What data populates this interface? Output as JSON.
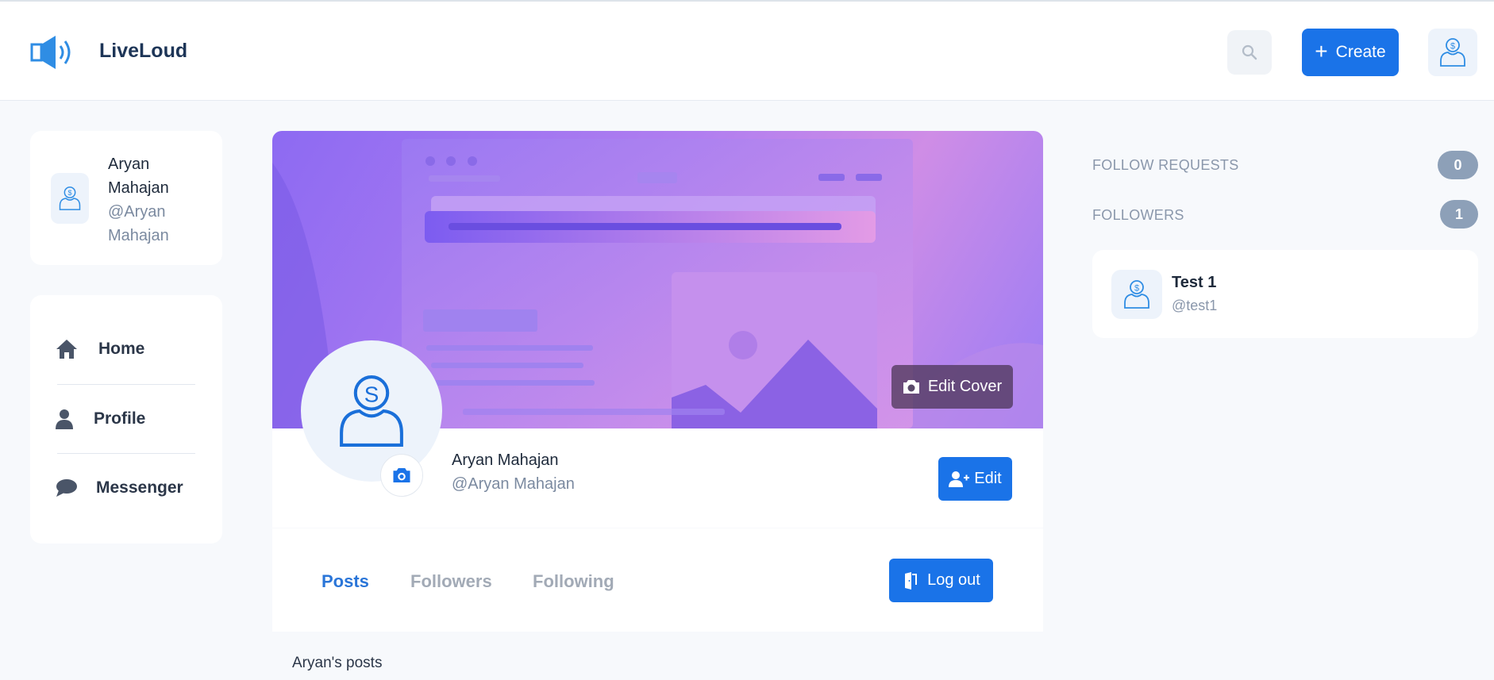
{
  "header": {
    "brand": "LiveLoud",
    "create_label": "Create"
  },
  "sidebar": {
    "user": {
      "name": "Aryan Mahajan",
      "handle": "@Aryan Mahajan"
    },
    "nav": [
      {
        "label": "Home",
        "icon": "home-icon"
      },
      {
        "label": "Profile",
        "icon": "user-icon"
      },
      {
        "label": "Messenger",
        "icon": "chat-icon"
      }
    ]
  },
  "profile": {
    "name": "Aryan Mahajan",
    "handle": "@Aryan Mahajan",
    "edit_cover_label": "Edit Cover",
    "edit_label": "Edit",
    "tabs": [
      {
        "label": "Posts",
        "active": true
      },
      {
        "label": "Followers",
        "active": false
      },
      {
        "label": "Following",
        "active": false
      }
    ],
    "logout_label": "Log out",
    "posts_title": "Aryan's posts"
  },
  "right": {
    "follow_requests_label": "FOLLOW REQUESTS",
    "follow_requests_count": "0",
    "followers_label": "FOLLOWERS",
    "followers_count": "1",
    "followers": [
      {
        "name": "Test 1",
        "handle": "@test1"
      }
    ]
  },
  "colors": {
    "accent": "#1a73e8",
    "badge": "#8da0b8",
    "cover_start": "#8d6af2",
    "cover_end": "#cf8de6"
  }
}
